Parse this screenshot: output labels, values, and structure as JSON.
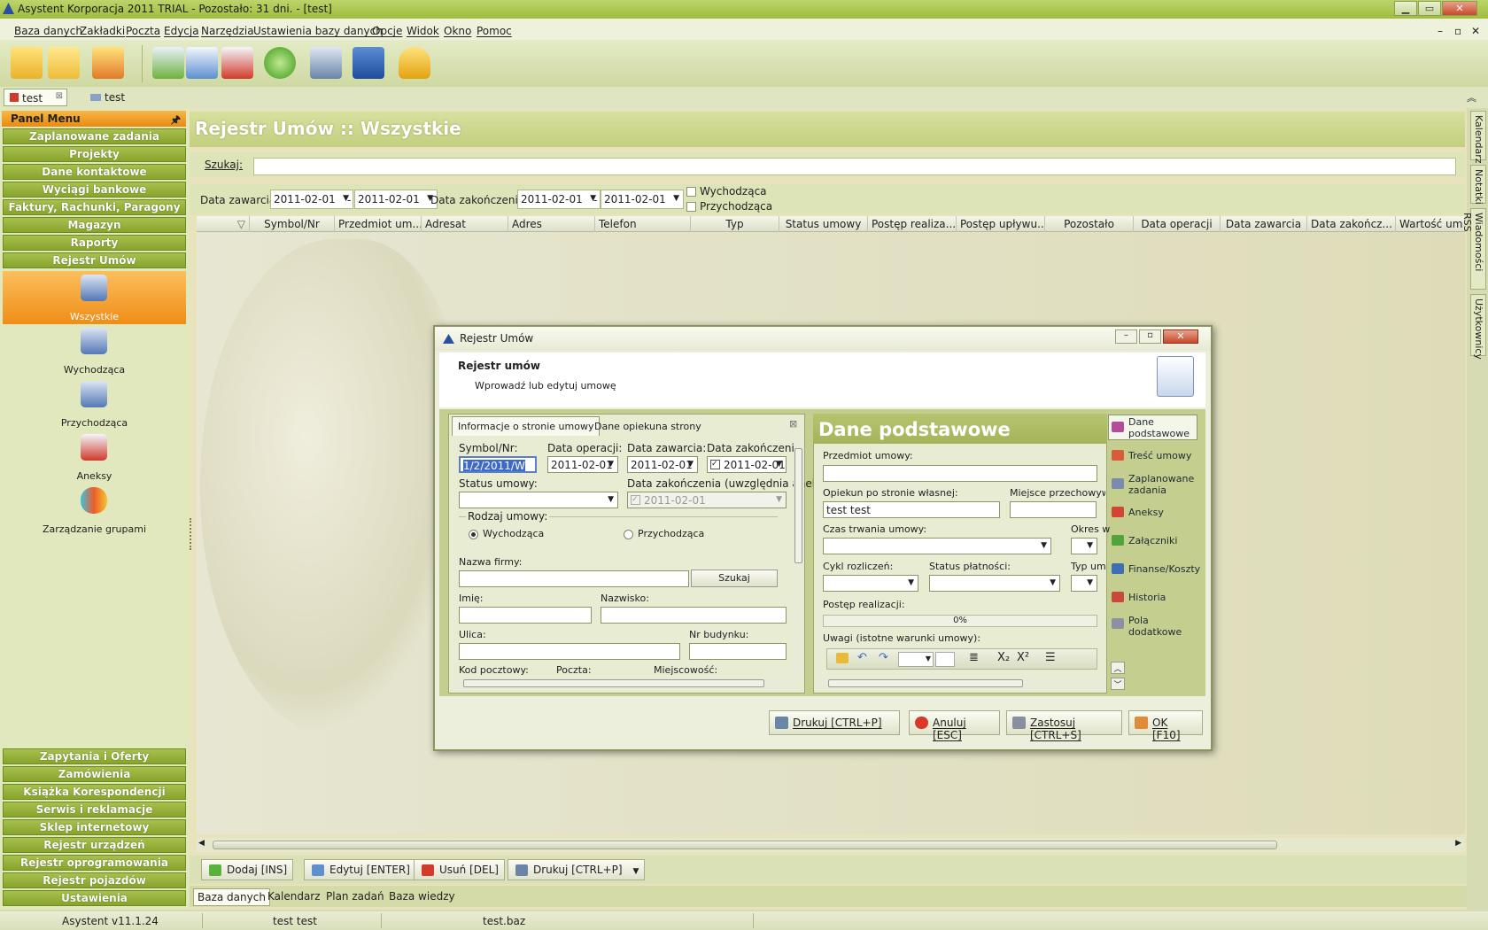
{
  "window": {
    "title": "Asystent Korporacja 2011 TRIAL - Pozostało: 31 dni. - [test]"
  },
  "menu": [
    "Baza danych",
    "Zakładki",
    "Poczta",
    "Edycja",
    "Narzędzia",
    "Ustawienia bazy danych",
    "Opcje",
    "Widok",
    "Okno",
    "Pomoc"
  ],
  "doc_tabs": [
    "test",
    "test"
  ],
  "panel": {
    "header": "Panel Menu",
    "top_items": [
      "Zaplanowane zadania",
      "Projekty",
      "Dane kontaktowe",
      "Wyciągi bankowe",
      "Faktury, Rachunki, Paragony",
      "Magazyn",
      "Raporty",
      "Rejestr Umów"
    ],
    "sub_items": [
      "Wszystkie",
      "Wychodząca",
      "Przychodząca",
      "Aneksy",
      "Zarządzanie grupami"
    ],
    "bottom_items": [
      "Zapytania i Oferty",
      "Zamówienia",
      "Książka Korespondencji",
      "Serwis i reklamacje",
      "Sklep internetowy",
      "Rejestr urządzeń",
      "Rejestr oprogramowania",
      "Rejestr pojazdów",
      "Ustawienia"
    ]
  },
  "main": {
    "title": "Rejestr Umów :: Wszystkie",
    "search_label": "Szukaj:",
    "filter": {
      "data_zawarcia_label": "Data zawarcia:",
      "from1": "2011-02-01",
      "dash": "-",
      "to1": "2011-02-01",
      "data_zakonczenia_label": "Data zakończenia:",
      "from2": "2011-02-01",
      "to2": "2011-02-01",
      "check1": "Wychodząca",
      "check2": "Przychodząca"
    },
    "columns": [
      "Symbol/Nr",
      "Przedmiot um...",
      "Adresat",
      "Adres",
      "Telefon",
      "Typ",
      "Status umowy",
      "Postęp realiza...",
      "Postęp upływu...",
      "Pozostało",
      "Data operacji",
      "Data zawarcia",
      "Data zakończ...",
      "Wartość um"
    ],
    "actions": [
      "Dodaj [INS]",
      "Edytuj [ENTER]",
      "Usuń [DEL]",
      "Drukuj [CTRL+P]"
    ],
    "bottom_tabs": [
      "Baza danych",
      "Kalendarz",
      "Plan zadań",
      "Baza wiedzy"
    ]
  },
  "right_tabs": [
    "Kalendarz",
    "Notatki",
    "Wiadomości RSS",
    "Użytkownicy"
  ],
  "status": {
    "version": "Asystent v11.1.24",
    "user": "test test",
    "file": "test.baz"
  },
  "dialog": {
    "title": "Rejestr Umów",
    "heading": "Rejestr umów",
    "subheading": "Wprowadź lub edytuj umowę",
    "tabs": [
      "Informacje o stronie umowy",
      "Dane opiekuna strony"
    ],
    "left": {
      "symbol_label": "Symbol/Nr:",
      "symbol_value": "1/2/2011/W",
      "data_operacji_label": "Data operacji:",
      "data_operacji": "2011-02-01",
      "data_zawarcia_label": "Data zawarcia:",
      "data_zawarcia": "2011-02-01",
      "data_zakonczenia_label": "Data zakończenia:",
      "data_zakonczenia": "2011-02-01",
      "status_label": "Status umowy:",
      "status_value": "",
      "zakonczenia_aneks_label": "Data zakończenia (uwzględnia anek",
      "zakonczenia_aneks": "2011-02-01",
      "rodzaj_label": "Rodzaj umowy:",
      "rodzaj_opt1": "Wychodząca",
      "rodzaj_opt2": "Przychodząca",
      "nazwa_label": "Nazwa firmy:",
      "szukaj": "Szukaj",
      "imie_label": "Imię:",
      "nazwisko_label": "Nazwisko:",
      "ulica_label": "Ulica:",
      "nr_label": "Nr budynku:",
      "kod_label": "Kod pocztowy:",
      "poczta_label": "Poczta:",
      "miejscowosc_label": "Miejscowość:"
    },
    "right": {
      "header": "Dane podstawowe",
      "przedmiot_label": "Przedmiot umowy:",
      "opiekun_label": "Opiekun po stronie własnej:",
      "opiekun_value": "test test",
      "miejsce_label": "Miejsce przechowyw",
      "czas_label": "Czas trwania umowy:",
      "okres_label": "Okres w",
      "cykl_label": "Cykl rozliczeń:",
      "status_platnosci_label": "Status płatności:",
      "typ_label": "Typ um",
      "postep_label": "Postęp realizacji:",
      "postep_value": "0%",
      "uwagi_label": "Uwagi (istotne warunki umowy):"
    },
    "side": [
      "Dane podstawowe",
      "Treść umowy",
      "Zaplanowane zadania",
      "Aneksy",
      "Załączniki",
      "Finanse/Koszty",
      "Historia",
      "Pola dodatkowe"
    ],
    "buttons": [
      "Drukuj [CTRL+P]",
      "Anuluj [ESC]",
      "Zastosuj [CTRL+S]",
      "OK [F10]"
    ]
  }
}
